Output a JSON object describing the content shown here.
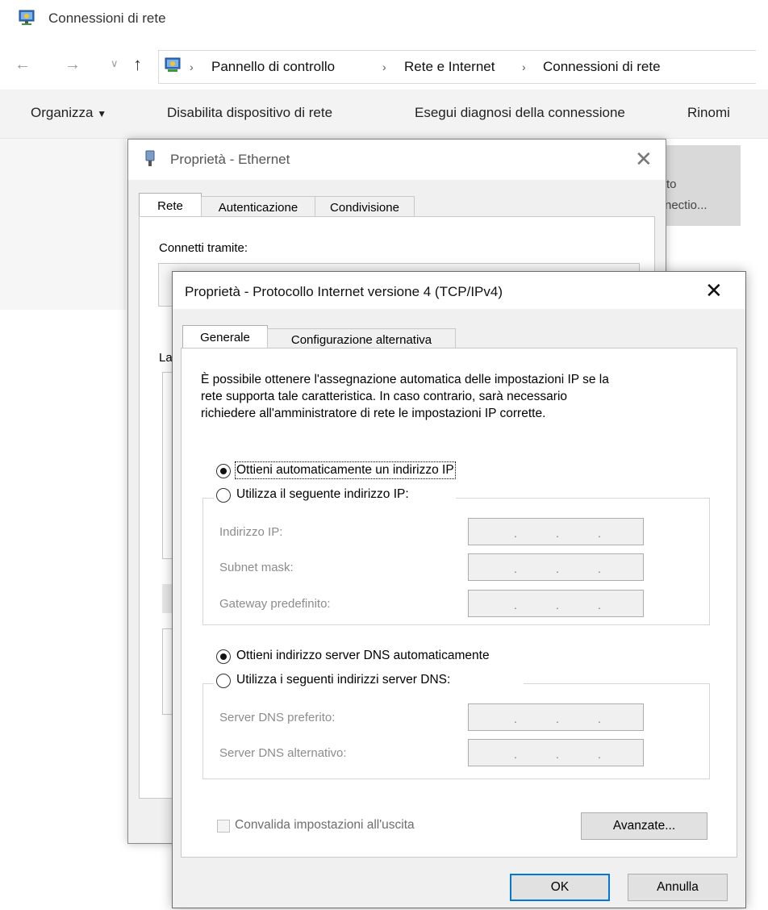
{
  "window": {
    "title": "Connessioni di rete"
  },
  "address_bar": {
    "crumbs": [
      "Pannello di controllo",
      "Rete e Internet",
      "Connessioni di rete"
    ]
  },
  "ribbon": {
    "organize": "Organizza",
    "disable": "Disabilita dispositivo di rete",
    "diagnose": "Esegui diagnosi della connessione",
    "rename": "Rinomi"
  },
  "background_item": {
    "line1": "to",
    "line2": "nectio..."
  },
  "ethernet_dialog": {
    "title": "Proprietà - Ethernet",
    "tabs": [
      "Rete",
      "Autenticazione",
      "Condivisione"
    ],
    "connect_label": "Connetti tramite:",
    "partial_label": "La"
  },
  "ipv4_dialog": {
    "title": "Proprietà - Protocollo Internet versione 4 (TCP/IPv4)",
    "tabs": [
      "Generale",
      "Configurazione alternativa"
    ],
    "description": [
      "È possibile ottenere l'assegnazione automatica delle impostazioni IP se la",
      "rete supporta tale caratteristica. In caso contrario, sarà necessario",
      "richiedere all'amministratore di rete le impostazioni IP corrette."
    ],
    "ip_auto": "Ottieni automaticamente un indirizzo IP",
    "ip_manual": "Utilizza il seguente indirizzo IP:",
    "ip_fields": [
      "Indirizzo IP:",
      "Subnet mask:",
      "Gateway predefinito:"
    ],
    "dns_auto": "Ottieni indirizzo server DNS automaticamente",
    "dns_manual": "Utilizza i seguenti indirizzi server DNS:",
    "dns_fields": [
      "Server DNS preferito:",
      "Server DNS alternativo:"
    ],
    "validate": "Convalida impostazioni all'uscita",
    "advanced": "Avanzate...",
    "ok": "OK",
    "cancel": "Annulla",
    "ip_mode_selected": "auto",
    "dns_mode_selected": "auto",
    "validate_checked": false
  }
}
